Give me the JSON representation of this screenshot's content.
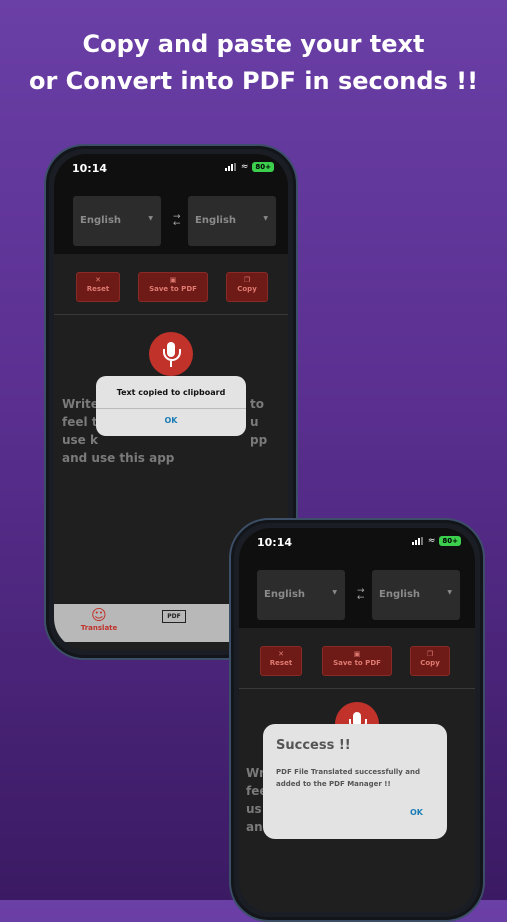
{
  "headline": [
    "Copy and paste your text",
    "or Convert into PDF in seconds !!"
  ],
  "phone1": {
    "time": "10:14",
    "battery": "80+",
    "source_lang": "English",
    "target_lang": "English",
    "buttons": {
      "reset": "Reset",
      "save_pdf": "Save to PDF",
      "copy": "Copy"
    },
    "bg_lines": [
      "Write",
      "feel t",
      "use k",
      "and use this app"
    ],
    "bg_right": [
      "to",
      "u",
      "pp"
    ],
    "alert_title": "Text copied to clipboard",
    "alert_ok": "OK",
    "tab_translate": "Translate",
    "tab_pdf_icon": "PDF"
  },
  "phone2": {
    "time": "10:14",
    "battery": "80+",
    "source_lang": "English",
    "target_lang": "English",
    "buttons": {
      "reset": "Reset",
      "save_pdf": "Save to PDF",
      "copy": "Copy"
    },
    "bg_lines": [
      "Wr",
      "fee",
      "us",
      "an"
    ],
    "success_title": "Success !!",
    "success_message": "PDF File Translated successfully and added to the PDF Manager !!",
    "success_ok": "OK"
  },
  "colors": {
    "accent_red": "#c0322a",
    "link_blue": "#1a7db5",
    "battery_green": "#3ccf4e"
  }
}
